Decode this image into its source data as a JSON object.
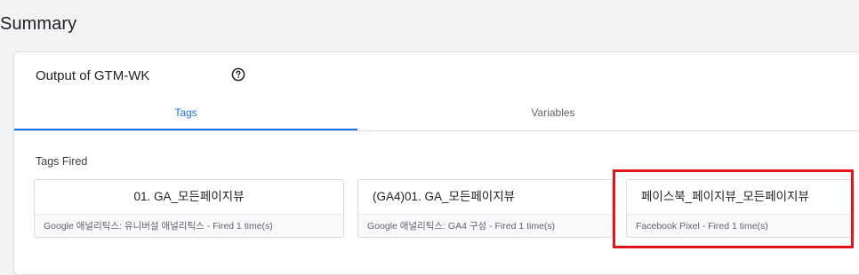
{
  "page": {
    "title": "Summary"
  },
  "output": {
    "title": "Output of GTM-WK",
    "help_icon": "help-circle-icon"
  },
  "tabs": [
    {
      "label": "Tags",
      "active": true
    },
    {
      "label": "Variables",
      "active": false
    }
  ],
  "tags_fired": {
    "label": "Tags Fired",
    "items": [
      {
        "name": "01. GA_모든페이지뷰",
        "meta": "Google 애널리틱스: 유니버설 애널리틱스 - Fired 1 time(s)"
      },
      {
        "name": "(GA4)01. GA_모든페이지뷰",
        "meta": "Google 애널리틱스: GA4 구성 - Fired 1 time(s)"
      },
      {
        "name": "페이스북_페이지뷰_모든페이지뷰",
        "meta": "Facebook Pixel - Fired 1 time(s)",
        "highlighted": true
      }
    ]
  },
  "colors": {
    "accent": "#1a73e8",
    "highlight": "#e0161b"
  }
}
